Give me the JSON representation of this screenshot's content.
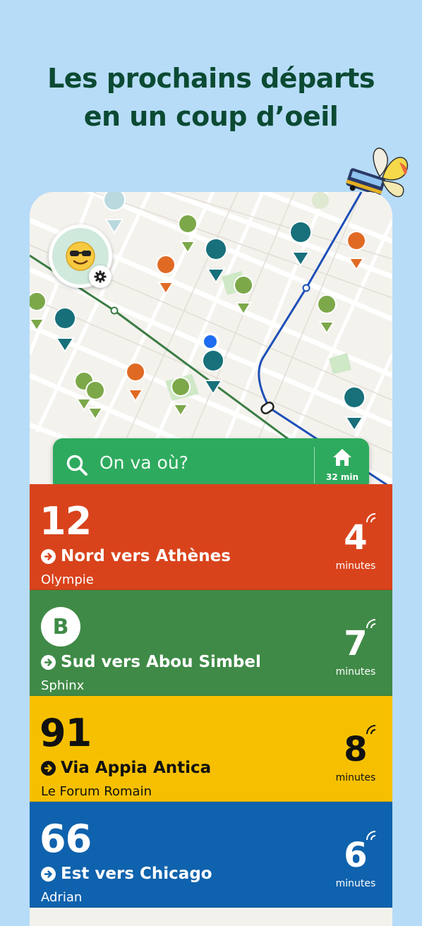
{
  "headline": {
    "line1": "Les prochains départs",
    "line2": "en un coup d’oeil"
  },
  "search": {
    "placeholder": "On va où?",
    "home_time": "32 min"
  },
  "departures": [
    {
      "route": "12",
      "direction": "Nord vers Athènes",
      "stop": "Olympie",
      "minutes": "4",
      "minutes_label": "minutes",
      "color": "#d9431c",
      "style": "number"
    },
    {
      "route": "B",
      "direction": "Sud vers Abou Simbel",
      "stop": "Sphinx",
      "minutes": "7",
      "minutes_label": "minutes",
      "color": "#3f8a47",
      "style": "badge"
    },
    {
      "route": "91",
      "direction": "Via Appia Antica",
      "stop": "Le Forum Romain",
      "minutes": "8",
      "minutes_label": "minutes",
      "color": "#f6c000",
      "style": "number"
    },
    {
      "route": "66",
      "direction": "Est vers Chicago",
      "stop": "Adrian",
      "minutes": "6",
      "minutes_label": "minutes",
      "color": "#0f62ad",
      "style": "number"
    }
  ],
  "icons": {
    "avatar": "sunglasses-emoji-icon",
    "gear": "gear-icon",
    "search": "search-icon",
    "home": "home-icon",
    "realtime": "realtime-signal-icon",
    "arrow": "arrow-right-circle-icon"
  },
  "colors": {
    "accent_green": "#2eaa5e",
    "headline": "#0b4a33",
    "background": "#b7dcf8"
  }
}
